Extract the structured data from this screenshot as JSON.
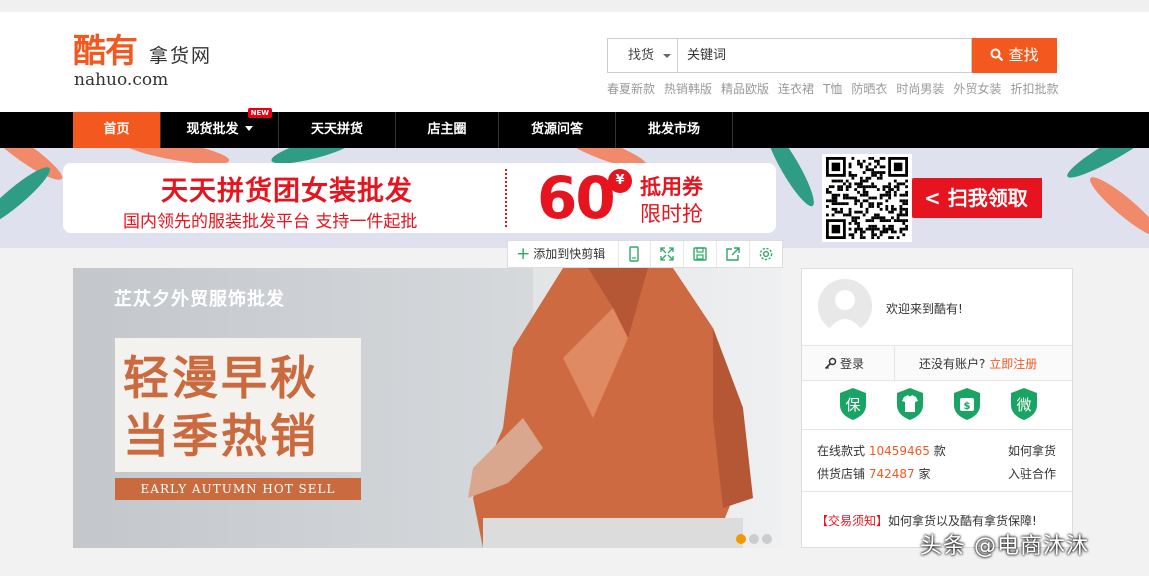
{
  "logo": {
    "chars": "酷有",
    "sub": "拿货网",
    "domain": "nahuo.com"
  },
  "search": {
    "category": "找货",
    "placeholder": "关键词",
    "button": "查找"
  },
  "hotwords": [
    "春夏新款",
    "热销韩版",
    "精品欧版",
    "连衣裙",
    "T恤",
    "防晒衣",
    "时尚男装",
    "外贸女装",
    "折扣批款"
  ],
  "nav": {
    "items": [
      "首页",
      "现货批发",
      "天天拼货",
      "店主圈",
      "货源问答",
      "批发市场"
    ],
    "new_badge": "NEW",
    "active_index": 0
  },
  "banner": {
    "title": "天天拼货团女装批发",
    "subtitle": "国内领先的服装批发平台  支持一件起批",
    "amount": "60",
    "currency": "¥",
    "coupon_line1": "抵用券",
    "coupon_line2": "限时抢",
    "scan_label": "< 扫我领取",
    "accent": "#e6141e"
  },
  "clipbar": {
    "add_label": "添加到快剪辑",
    "icons": [
      "phone-icon",
      "expand-icon",
      "save-icon",
      "share-icon",
      "settings-icon"
    ]
  },
  "slide": {
    "brand": "芷苁夕外贸服饰批发",
    "headline1": "轻漫早秋",
    "headline2": "当季热销",
    "tagline": "EARLY AUTUMN HOT SELL",
    "active_dot": 0,
    "dot_count": 3
  },
  "panel": {
    "welcome": "欢迎来到酷有!",
    "login": "登录",
    "no_account": "还没有账户?",
    "register": "立即注册",
    "badges": [
      "保",
      "衣",
      "$",
      "微"
    ],
    "online_label": "在线款式",
    "online_count": "10459465",
    "online_unit": "款",
    "shops_label": "供货店铺",
    "shops_count": "742487",
    "shops_unit": "家",
    "how_to": "如何拿货",
    "join": "入驻合作",
    "notice_tag": "【交易须知】",
    "notice_text": "如何拿货以及酷有拿货保障!"
  },
  "watermark": "头条 @电商沐沐",
  "colors": {
    "brand": "#f3591f",
    "nav_bg": "#000000",
    "shield": "#19a463"
  }
}
